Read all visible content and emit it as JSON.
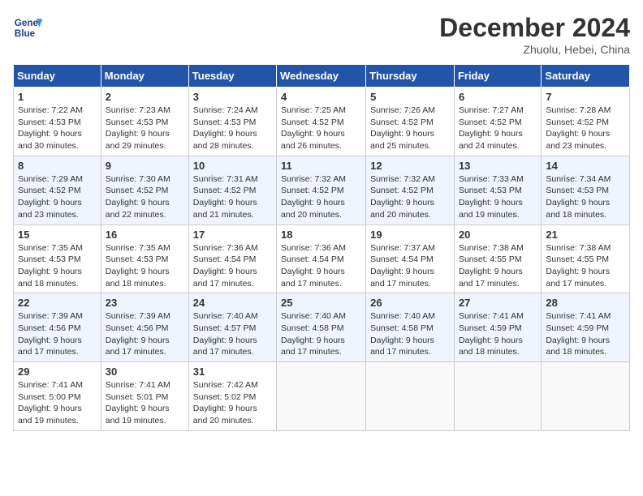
{
  "header": {
    "logo_line1": "General",
    "logo_line2": "Blue",
    "month": "December 2024",
    "location": "Zhuolu, Hebei, China"
  },
  "weekdays": [
    "Sunday",
    "Monday",
    "Tuesday",
    "Wednesday",
    "Thursday",
    "Friday",
    "Saturday"
  ],
  "weeks": [
    [
      {
        "day": "1",
        "sunrise": "7:22 AM",
        "sunset": "4:53 PM",
        "daylight": "9 hours and 30 minutes."
      },
      {
        "day": "2",
        "sunrise": "7:23 AM",
        "sunset": "4:53 PM",
        "daylight": "9 hours and 29 minutes."
      },
      {
        "day": "3",
        "sunrise": "7:24 AM",
        "sunset": "4:53 PM",
        "daylight": "9 hours and 28 minutes."
      },
      {
        "day": "4",
        "sunrise": "7:25 AM",
        "sunset": "4:52 PM",
        "daylight": "9 hours and 26 minutes."
      },
      {
        "day": "5",
        "sunrise": "7:26 AM",
        "sunset": "4:52 PM",
        "daylight": "9 hours and 25 minutes."
      },
      {
        "day": "6",
        "sunrise": "7:27 AM",
        "sunset": "4:52 PM",
        "daylight": "9 hours and 24 minutes."
      },
      {
        "day": "7",
        "sunrise": "7:28 AM",
        "sunset": "4:52 PM",
        "daylight": "9 hours and 23 minutes."
      }
    ],
    [
      {
        "day": "8",
        "sunrise": "7:29 AM",
        "sunset": "4:52 PM",
        "daylight": "9 hours and 23 minutes."
      },
      {
        "day": "9",
        "sunrise": "7:30 AM",
        "sunset": "4:52 PM",
        "daylight": "9 hours and 22 minutes."
      },
      {
        "day": "10",
        "sunrise": "7:31 AM",
        "sunset": "4:52 PM",
        "daylight": "9 hours and 21 minutes."
      },
      {
        "day": "11",
        "sunrise": "7:32 AM",
        "sunset": "4:52 PM",
        "daylight": "9 hours and 20 minutes."
      },
      {
        "day": "12",
        "sunrise": "7:32 AM",
        "sunset": "4:52 PM",
        "daylight": "9 hours and 20 minutes."
      },
      {
        "day": "13",
        "sunrise": "7:33 AM",
        "sunset": "4:53 PM",
        "daylight": "9 hours and 19 minutes."
      },
      {
        "day": "14",
        "sunrise": "7:34 AM",
        "sunset": "4:53 PM",
        "daylight": "9 hours and 18 minutes."
      }
    ],
    [
      {
        "day": "15",
        "sunrise": "7:35 AM",
        "sunset": "4:53 PM",
        "daylight": "9 hours and 18 minutes."
      },
      {
        "day": "16",
        "sunrise": "7:35 AM",
        "sunset": "4:53 PM",
        "daylight": "9 hours and 18 minutes."
      },
      {
        "day": "17",
        "sunrise": "7:36 AM",
        "sunset": "4:54 PM",
        "daylight": "9 hours and 17 minutes."
      },
      {
        "day": "18",
        "sunrise": "7:36 AM",
        "sunset": "4:54 PM",
        "daylight": "9 hours and 17 minutes."
      },
      {
        "day": "19",
        "sunrise": "7:37 AM",
        "sunset": "4:54 PM",
        "daylight": "9 hours and 17 minutes."
      },
      {
        "day": "20",
        "sunrise": "7:38 AM",
        "sunset": "4:55 PM",
        "daylight": "9 hours and 17 minutes."
      },
      {
        "day": "21",
        "sunrise": "7:38 AM",
        "sunset": "4:55 PM",
        "daylight": "9 hours and 17 minutes."
      }
    ],
    [
      {
        "day": "22",
        "sunrise": "7:39 AM",
        "sunset": "4:56 PM",
        "daylight": "9 hours and 17 minutes."
      },
      {
        "day": "23",
        "sunrise": "7:39 AM",
        "sunset": "4:56 PM",
        "daylight": "9 hours and 17 minutes."
      },
      {
        "day": "24",
        "sunrise": "7:40 AM",
        "sunset": "4:57 PM",
        "daylight": "9 hours and 17 minutes."
      },
      {
        "day": "25",
        "sunrise": "7:40 AM",
        "sunset": "4:58 PM",
        "daylight": "9 hours and 17 minutes."
      },
      {
        "day": "26",
        "sunrise": "7:40 AM",
        "sunset": "4:58 PM",
        "daylight": "9 hours and 17 minutes."
      },
      {
        "day": "27",
        "sunrise": "7:41 AM",
        "sunset": "4:59 PM",
        "daylight": "9 hours and 18 minutes."
      },
      {
        "day": "28",
        "sunrise": "7:41 AM",
        "sunset": "4:59 PM",
        "daylight": "9 hours and 18 minutes."
      }
    ],
    [
      {
        "day": "29",
        "sunrise": "7:41 AM",
        "sunset": "5:00 PM",
        "daylight": "9 hours and 19 minutes."
      },
      {
        "day": "30",
        "sunrise": "7:41 AM",
        "sunset": "5:01 PM",
        "daylight": "9 hours and 19 minutes."
      },
      {
        "day": "31",
        "sunrise": "7:42 AM",
        "sunset": "5:02 PM",
        "daylight": "9 hours and 20 minutes."
      },
      null,
      null,
      null,
      null
    ]
  ]
}
